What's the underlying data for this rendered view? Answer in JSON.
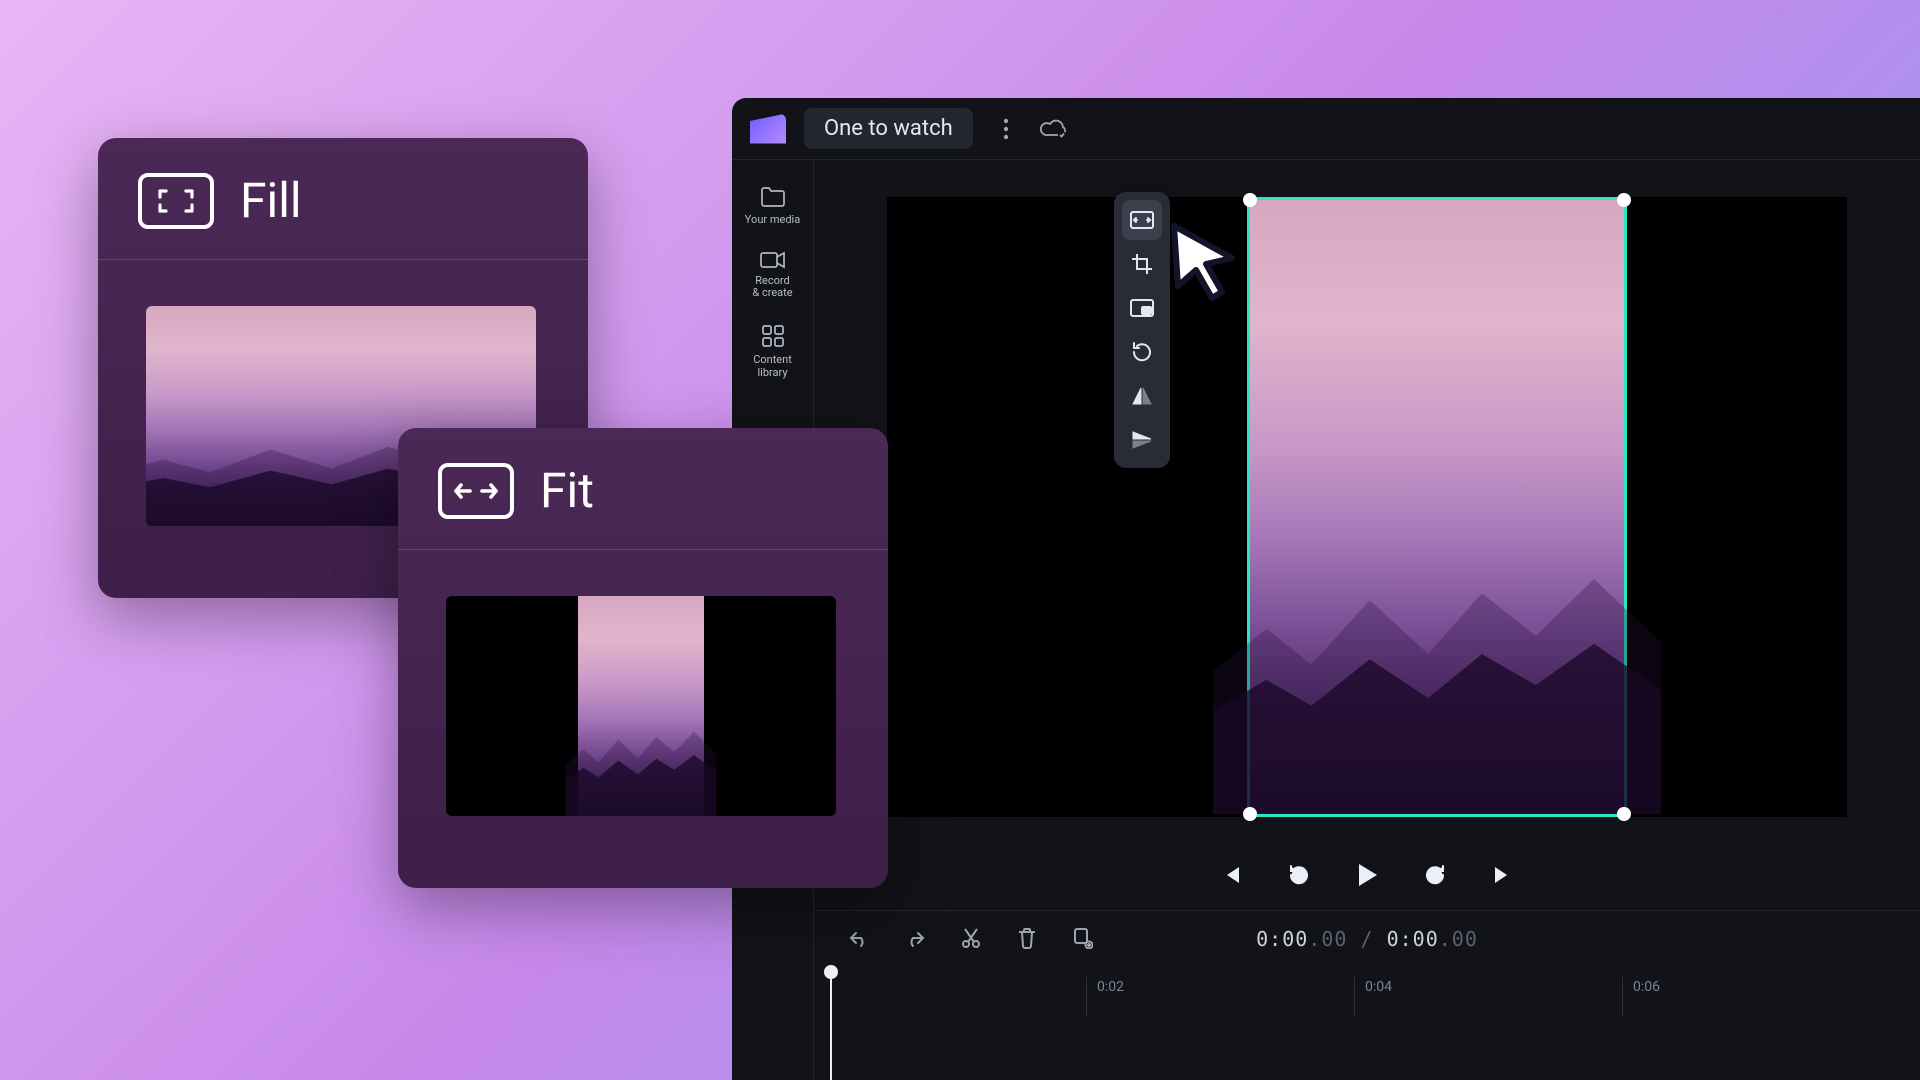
{
  "cards": {
    "fill": {
      "title": "Fill"
    },
    "fit": {
      "title": "Fit"
    }
  },
  "project": {
    "title": "One to watch"
  },
  "sidebar": {
    "items": [
      {
        "label": "Your media"
      },
      {
        "label": "Record\n& create"
      },
      {
        "label": "Content\nlibrary"
      }
    ]
  },
  "toolstrip": {
    "items": [
      {
        "name": "fit-fill",
        "active": true
      },
      {
        "name": "crop"
      },
      {
        "name": "pip"
      },
      {
        "name": "rotate"
      },
      {
        "name": "flip-horizontal"
      },
      {
        "name": "flip-vertical"
      }
    ]
  },
  "timeline": {
    "current": "0:00",
    "current_frac": ".00",
    "total": "0:00",
    "total_frac": ".00",
    "ticks": [
      "0:02",
      "0:04",
      "0:06"
    ]
  }
}
